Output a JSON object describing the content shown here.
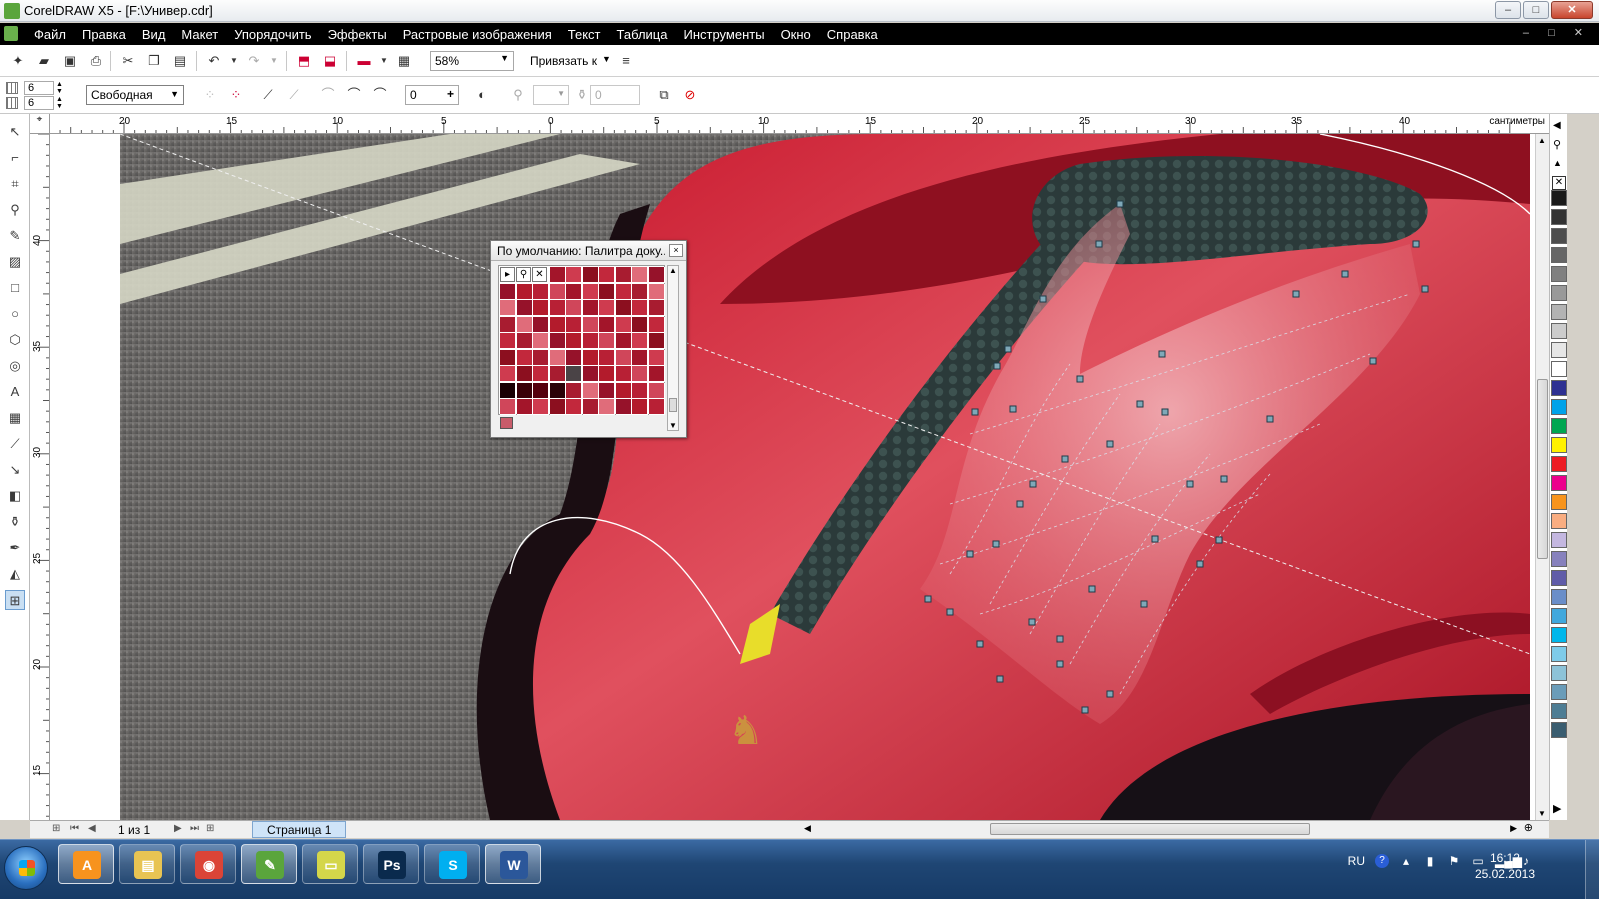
{
  "window": {
    "title": "CorelDRAW X5 - [F:\\Универ.cdr]",
    "minimize": "–",
    "maximize": "□",
    "close": "✕"
  },
  "menu": {
    "items": [
      "Файл",
      "Правка",
      "Вид",
      "Макет",
      "Упорядочить",
      "Эффекты",
      "Растровые изображения",
      "Текст",
      "Таблица",
      "Инструменты",
      "Окно",
      "Справка"
    ],
    "doc_controls": "– □ ✕"
  },
  "toolbar": {
    "zoom_value": "58%",
    "snap_label": "Привязать к"
  },
  "property_bar": {
    "rows_value": "6",
    "cols_value": "6",
    "mode_select": "Свободная",
    "offset_value": "0",
    "transparency_value": "0"
  },
  "rulers": {
    "h_labels": [
      "20",
      "15",
      "10",
      "5",
      "0",
      "5",
      "10",
      "15",
      "20",
      "25",
      "30",
      "35",
      "40"
    ],
    "v_labels": [
      "40",
      "35",
      "30",
      "25",
      "20",
      "15"
    ],
    "unit": "сантиметры"
  },
  "palette_docker": {
    "title": "По умолчанию: Палитра доку...",
    "close": "×"
  },
  "palette_colors": [
    "#1a1a1a",
    "#333333",
    "#4d4d4d",
    "#666666",
    "#808080",
    "#999999",
    "#b3b3b3",
    "#cccccc",
    "#e6e6e6",
    "#ffffff",
    "#2e3192",
    "#00a2e9",
    "#00a651",
    "#fff200",
    "#ed1c24",
    "#ec008c",
    "#f7941d",
    "#f9ad81",
    "#c4b7e0",
    "#8781bd",
    "#605ca8",
    "#6a8ec9",
    "#41a8dd",
    "#00b7eb",
    "#7ecbe9",
    "#8dc3d8",
    "#6a9cb9",
    "#4e7d94",
    "#3a5d70"
  ],
  "pagebar": {
    "pager": "1 из 1",
    "page_tab": "Страница 1"
  },
  "taskbar": {
    "apps": [
      {
        "name": "avast",
        "glyph": "A",
        "color": "#f7931e"
      },
      {
        "name": "explorer",
        "glyph": "▤",
        "color": "#e8c453"
      },
      {
        "name": "chrome",
        "glyph": "◉",
        "color": "#db4437"
      },
      {
        "name": "coreldraw",
        "glyph": "✎",
        "color": "#5aa53c"
      },
      {
        "name": "sticky-notes",
        "glyph": "▭",
        "color": "#d4d64a"
      },
      {
        "name": "photoshop",
        "glyph": "Ps",
        "color": "#0a2a4d"
      },
      {
        "name": "skype",
        "glyph": "S",
        "color": "#00aff0"
      },
      {
        "name": "word",
        "glyph": "W",
        "color": "#2b579a"
      }
    ],
    "lang": "RU",
    "time": "16:12",
    "date": "25.02.2013"
  }
}
